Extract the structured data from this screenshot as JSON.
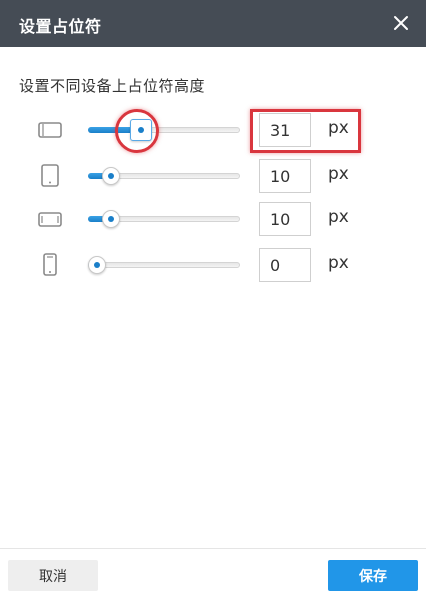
{
  "dialog": {
    "title": "设置占位符",
    "subtitle": "设置不同设备上占位符高度"
  },
  "devices": [
    {
      "icon": "desktop-icon",
      "value": "31",
      "unit": "px",
      "slider_level": 0.31
    },
    {
      "icon": "tablet-portrait-icon",
      "value": "10",
      "unit": "px",
      "slider_level": 0.1
    },
    {
      "icon": "tablet-landscape-icon",
      "value": "10",
      "unit": "px",
      "slider_level": 0.1
    },
    {
      "icon": "phone-icon",
      "value": "0",
      "unit": "px",
      "slider_level": 0.0
    }
  ],
  "footer": {
    "cancel_label": "取消",
    "save_label": "保存"
  },
  "colors": {
    "header_bg": "#454c55",
    "accent": "#2196e8",
    "highlight": "#d9363e"
  }
}
